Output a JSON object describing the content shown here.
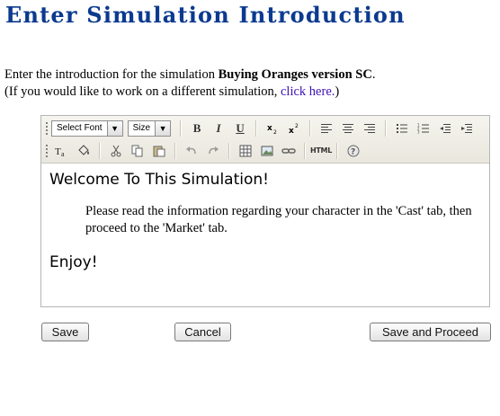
{
  "page": {
    "title": "Enter Simulation Introduction"
  },
  "intro": {
    "prefix": "Enter the introduction for the simulation ",
    "simulation_name": "Buying Oranges version SC",
    "suffix": ".",
    "switch_prefix": "(If you would like to work on a different simulation, ",
    "switch_link": "click here.",
    "switch_suffix": ")"
  },
  "editor": {
    "toolbar": {
      "font_select": "Select Font",
      "size_select": "Size",
      "bold": "B",
      "italic": "I",
      "underline": "U",
      "html": "HTML",
      "help": "?"
    },
    "content": {
      "welcome": "Welcome To This Simulation!",
      "body": "Please read the information regarding your character in the 'Cast' tab, then proceed to the 'Market' tab.",
      "closing": "Enjoy!"
    }
  },
  "actions": {
    "save": "Save",
    "cancel": "Cancel",
    "save_and_proceed": "Save and Proceed"
  },
  "colors": {
    "title": "#0b3a8f",
    "link": "#3f12b4",
    "toolbar_bg": "#efede4"
  }
}
